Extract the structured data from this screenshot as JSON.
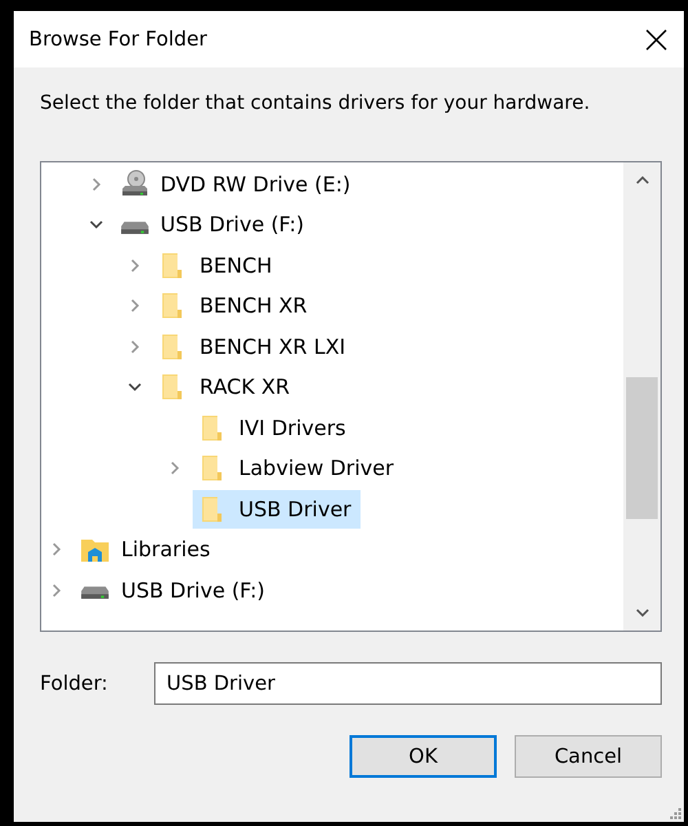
{
  "window": {
    "title": "Browse For Folder"
  },
  "instruction": "Select the folder that contains drivers for your hardware.",
  "tree": {
    "items": [
      {
        "children": [
          {
            "label": "DVD RW Drive (E:)",
            "kind": "dvd",
            "expanded": false,
            "selected": false
          },
          {
            "label": "USB Drive (F:)",
            "kind": "drive",
            "expanded": true,
            "selected": false,
            "children": [
              {
                "label": "BENCH",
                "kind": "folder",
                "expanded": false,
                "selected": false
              },
              {
                "label": "BENCH XR",
                "kind": "folder",
                "expanded": false,
                "selected": false
              },
              {
                "label": "BENCH XR LXI",
                "kind": "folder",
                "expanded": false,
                "selected": false
              },
              {
                "label": "RACK XR",
                "kind": "folder",
                "expanded": true,
                "selected": false,
                "children": [
                  {
                    "label": "IVI Drivers",
                    "kind": "folder",
                    "selected": false
                  },
                  {
                    "label": "Labview Driver",
                    "kind": "folder",
                    "expanded": false,
                    "selected": false
                  },
                  {
                    "label": "USB Driver",
                    "kind": "folder",
                    "selected": true
                  }
                ]
              }
            ]
          }
        ]
      },
      {
        "label": "Libraries",
        "kind": "libraries",
        "expanded": false,
        "selected": false
      },
      {
        "label": "USB Drive (F:)",
        "kind": "drive",
        "expanded": false,
        "selected": false
      }
    ]
  },
  "folder": {
    "label": "Folder:",
    "value": "USB Driver"
  },
  "buttons": [
    {
      "label": "OK",
      "default": true
    },
    {
      "label": "Cancel",
      "default": false
    }
  ]
}
